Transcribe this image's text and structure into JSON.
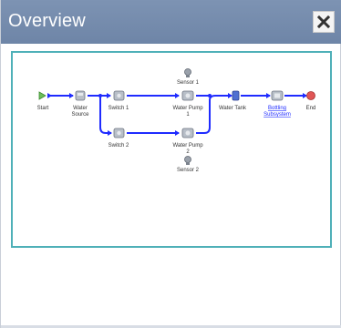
{
  "window": {
    "title": "Overview",
    "close_icon": "close-icon",
    "accent_color": "#6e85a7",
    "frame_color": "#4fb0b8"
  },
  "map": {
    "nodes": [
      {
        "id": "start",
        "label": "Start",
        "icon": "start-icon"
      },
      {
        "id": "water-source",
        "label": "Water Source",
        "icon": "valve-icon"
      },
      {
        "id": "switch-1",
        "label": "Switch 1",
        "icon": "switch-icon"
      },
      {
        "id": "switch-2",
        "label": "Switch 2",
        "icon": "switch-icon"
      },
      {
        "id": "water-pump-1",
        "label": "Water Pump 1",
        "icon": "pump-icon"
      },
      {
        "id": "water-pump-2",
        "label": "Water Pump 2",
        "icon": "pump-icon"
      },
      {
        "id": "sensor-1",
        "label": "Sensor 1",
        "icon": "sensor-icon"
      },
      {
        "id": "sensor-2",
        "label": "Sensor 2",
        "icon": "sensor-icon"
      },
      {
        "id": "water-tank",
        "label": "Water Tank",
        "icon": "tank-icon"
      },
      {
        "id": "bottling-subsystem",
        "label": "Bottling Subsystem",
        "icon": "subsystem-icon",
        "link": true
      },
      {
        "id": "end",
        "label": "End",
        "icon": "end-icon"
      }
    ],
    "pipe_color": "#1f2bff",
    "start_color": "#6cc05a",
    "end_color": "#e05656"
  }
}
